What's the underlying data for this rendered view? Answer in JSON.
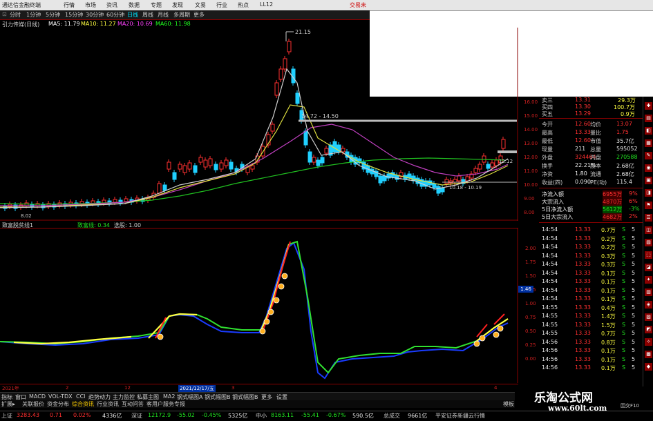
{
  "titlebar": {
    "app": "通达信金融终端",
    "menus": [
      "行情",
      "市场",
      "资讯",
      "数据",
      "专题",
      "发现",
      "文易",
      "行业",
      "热点",
      "LL12"
    ],
    "right": "交易未"
  },
  "tabs": [
    "分时",
    "1分钟",
    "5分钟",
    "15分钟",
    "30分钟",
    "60分钟",
    "日线",
    "周线",
    "月线",
    "多周期",
    "更多"
  ],
  "legend": {
    "name": "引力传媒(日线)",
    "ma5": "MA5: 11.79",
    "ma10": "MA10: 11.27",
    "ma20": "MA20: 10.69",
    "ma60": "MA60: 11.98"
  },
  "price_axis": [
    "16.00",
    "15.00",
    "14.00",
    "13.00",
    "12.00",
    "11.00",
    "10.00",
    "9.00",
    "8.00"
  ],
  "price_annotations": {
    "high": "21.15",
    "range": "14.72 - 14.50",
    "low_mark": "10.18 - 10.19",
    "right_mark": "12.12",
    "start": "8.02"
  },
  "sub_axis": [
    "2.00",
    "1.75",
    "1.50",
    "1.25",
    "1.00",
    "0.75",
    "0.50",
    "0.25",
    "0.00"
  ],
  "sub_marker": "1.46",
  "subhead": {
    "name": "致富脱贫线1",
    "v2": "致富线: 0.34",
    "v3": "选股: 1.00"
  },
  "orderbook": [
    {
      "label": "卖三",
      "price": "13.31",
      "extra": "29.3万"
    },
    {
      "label": "买四",
      "price": "13.30",
      "extra": "100.7万"
    },
    {
      "label": "买五",
      "price": "13.29",
      "extra": "0.9万"
    }
  ],
  "quote": [
    {
      "l1": "今开",
      "v1": "12.60",
      "l2": "均价",
      "v2": "13.07"
    },
    {
      "l1": "最高",
      "v1": "13.33",
      "l2": "量比",
      "v2": "1.75"
    },
    {
      "l1": "最低",
      "v1": "12.60",
      "l2": "市值",
      "v2": "35.7亿"
    },
    {
      "l1": "现量",
      "v1": "211",
      "l2": "总量",
      "v2": "595052"
    },
    {
      "l1": "外盘",
      "v1": "324464",
      "l2": "内盘",
      "v2": "270588"
    },
    {
      "l1": "换手",
      "v1": "22.21%",
      "l2": "股本",
      "v2": "2.68亿"
    },
    {
      "l1": "净资",
      "v1": "1.80",
      "l2": "流通",
      "v2": "2.68亿"
    },
    {
      "l1": "收益(四)",
      "v1": "0.090",
      "l2": "PE(动)",
      "v2": "115.4"
    }
  ],
  "flows": [
    {
      "label": "净流入额",
      "value": "6955万",
      "pct": "9%"
    },
    {
      "label": "大宗流入",
      "value": "4870万",
      "pct": "6%"
    },
    {
      "label": "5日净流入额",
      "value": "5612万",
      "pct": "-3%"
    },
    {
      "label": "5日大宗流入",
      "value": "4682万",
      "pct": "2%"
    }
  ],
  "ticks": [
    {
      "t": "14:54",
      "p": "13.33",
      "v": "0.7万",
      "s": "S",
      "n": "5"
    },
    {
      "t": "14:54",
      "p": "13.33",
      "v": "0.2万",
      "s": "S",
      "n": "5"
    },
    {
      "t": "14:54",
      "p": "13.33",
      "v": "0.2万",
      "s": "S",
      "n": "5"
    },
    {
      "t": "14:54",
      "p": "13.33",
      "v": "0.3万",
      "s": "S",
      "n": "5"
    },
    {
      "t": "14:54",
      "p": "13.33",
      "v": "0.3万",
      "s": "S",
      "n": "5"
    },
    {
      "t": "14:54",
      "p": "13.33",
      "v": "0.1万",
      "s": "S",
      "n": "5"
    },
    {
      "t": "14:54",
      "p": "13.33",
      "v": "0.1万",
      "s": "S",
      "n": "5"
    },
    {
      "t": "14:54",
      "p": "13.33",
      "v": "0.1万",
      "s": "S",
      "n": "5"
    },
    {
      "t": "14:54",
      "p": "13.33",
      "v": "0.1万",
      "s": "S",
      "n": "5"
    },
    {
      "t": "14:55",
      "p": "13.33",
      "v": "0.4万",
      "s": "S",
      "n": "5"
    },
    {
      "t": "14:55",
      "p": "13.33",
      "v": "1.4万",
      "s": "S",
      "n": "5"
    },
    {
      "t": "14:55",
      "p": "13.33",
      "v": "1.5万",
      "s": "S",
      "n": "5"
    },
    {
      "t": "14:55",
      "p": "13.33",
      "v": "0.7万",
      "s": "S",
      "n": "5"
    },
    {
      "t": "14:56",
      "p": "13.33",
      "v": "0.8万",
      "s": "S",
      "n": "5"
    },
    {
      "t": "14:56",
      "p": "13.33",
      "v": "0.1万",
      "s": "S",
      "n": "5"
    },
    {
      "t": "14:56",
      "p": "13.33",
      "v": "0.1万",
      "s": "S",
      "n": "5"
    },
    {
      "t": "14:56",
      "p": "13.33",
      "v": "0.1万",
      "s": "S",
      "n": "5"
    }
  ],
  "date_axis": [
    "2021年",
    "2",
    "12",
    "2021/12/17/五",
    "3",
    "4"
  ],
  "toolbar": [
    "指标",
    "窗口",
    "MACD",
    "VOL-TDX",
    "CCI",
    "趋势动力",
    "主力监控",
    "私募主图",
    "MA2",
    "钢式幅图A",
    "钢式幅图B",
    "钢式幅图B",
    "更多",
    "设置"
  ],
  "toolbar2": [
    "扩展▸",
    "关联报价",
    "资金分布",
    "综合资讯",
    "行业资讯",
    "互动问答",
    "客用户服务专报"
  ],
  "toolbar2_right": "模板",
  "status": [
    {
      "name": "上证",
      "val": "3283.43",
      "chg": "0.71",
      "pct": "0.02%",
      "amt": "4336亿"
    },
    {
      "name": "深证",
      "val": "12172.9",
      "chg": "-55.02",
      "pct": "-0.45%",
      "amt": "5325亿"
    },
    {
      "name": "中小",
      "val": "8163.11",
      "chg": "-55.41",
      "pct": "-0.67%",
      "amt": "590.5亿"
    }
  ],
  "status_total": {
    "label": "总成交",
    "val": "9661亿"
  },
  "status_right": "平安证券新疆云行情",
  "watermark": {
    "cn": "乐淘公式网",
    "url": "www.60lt.com"
  },
  "side_label": "因交F10"
}
